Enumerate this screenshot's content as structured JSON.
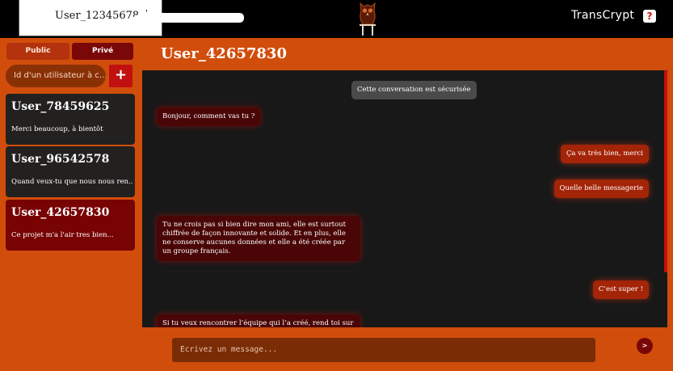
{
  "header": {
    "username_field_value": "User_12345678",
    "brand": "TransCrypt",
    "help_label": "?"
  },
  "sidebar": {
    "tab_public": "Public",
    "tab_private": "Privé",
    "search_placeholder": "Id d'un utilisateur à c...",
    "add_label": "+",
    "conversations": [
      {
        "name": "User_78459625",
        "preview": "Merci beaucoup, à bientôt"
      },
      {
        "name": "User_96542578",
        "preview": "Quand veux-tu que nous nous ren..."
      },
      {
        "name": "User_42657830",
        "preview": "Ce projet m'a l'air tres bien..."
      }
    ]
  },
  "chat": {
    "title": "User_42657830",
    "system_notice": "Cette conversation est sécurisée",
    "messages": [
      {
        "direction": "in",
        "text": "Bonjour, comment vas tu ?"
      },
      {
        "direction": "out",
        "text": "Ça va très bien, merci"
      },
      {
        "direction": "out",
        "text": "Quelle belle messagerie"
      },
      {
        "direction": "in",
        "text": "Tu ne crois pas si bien dire mon ami, elle est surtout chiffrée de façon innovante et solide. Et en plus, elle ne conserve aucunes données et elle a été créée par un groupe français."
      },
      {
        "direction": "out",
        "text": "C’est super !"
      },
      {
        "direction": "in",
        "text": "Si tu veux rencontrer l’équipe qui l’a créé, rend toi sur le"
      }
    ],
    "composer_placeholder": "Ecrivez un message...",
    "send_label": ">"
  },
  "colors": {
    "accent_orange": "#d14d0b",
    "dark_red": "#780303",
    "chat_background": "#181818"
  }
}
